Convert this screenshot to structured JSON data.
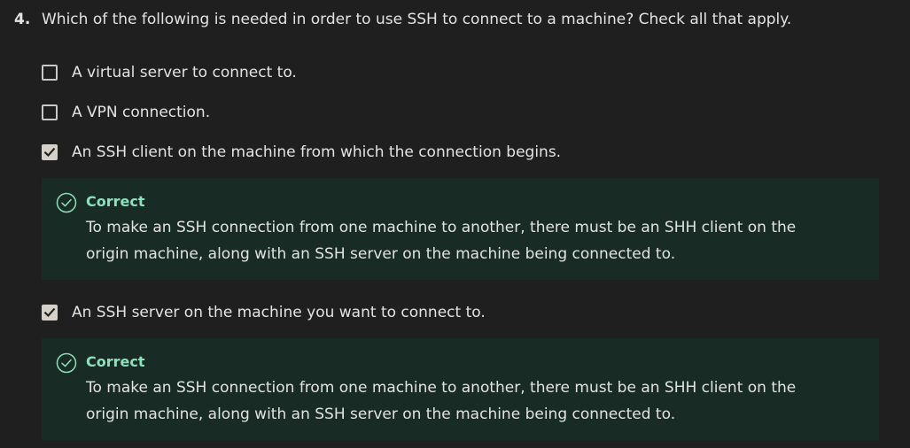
{
  "question": {
    "number": "4.",
    "text": "Which of the following is needed in order to use SSH to connect to a machine? Check all that apply."
  },
  "options": [
    {
      "label": "A virtual server to connect to.",
      "checked": false
    },
    {
      "label": "A VPN connection.",
      "checked": false
    },
    {
      "label": "An SSH client on the machine from which the connection begins.",
      "checked": true
    },
    {
      "label": "An SSH server on the machine you want to connect to.",
      "checked": true
    }
  ],
  "feedback": [
    {
      "status": "Correct",
      "text": "To make an SSH connection from one machine to another, there must be an SHH client on the origin machine, along with an SSH server on the machine being connected to."
    },
    {
      "status": "Correct",
      "text": "To make an SSH connection from one machine to another, there must be an SHH client on the origin machine, along with an SSH server on the machine being connected to."
    }
  ],
  "colors": {
    "background": "#1f1f1f",
    "feedback_background": "#182b24",
    "correct_accent": "#8fe0bc",
    "text": "#e3e3e3"
  }
}
